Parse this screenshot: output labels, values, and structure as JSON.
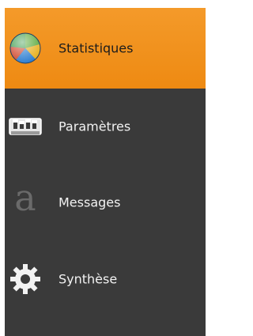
{
  "menu": {
    "items": [
      {
        "label": "Statistiques",
        "icon": "pie-chart-icon",
        "active": true
      },
      {
        "label": "Paramètres",
        "icon": "settings-panel-icon",
        "active": false
      },
      {
        "label": "Messages",
        "icon": "letter-a-icon",
        "active": false
      },
      {
        "label": "Synthèse",
        "icon": "gear-icon",
        "active": false
      }
    ]
  },
  "colors": {
    "menu_background": "#3a3a3a",
    "active_background": "#f09018",
    "active_text": "#1c1c1c",
    "inactive_text": "#f2f2f2"
  }
}
